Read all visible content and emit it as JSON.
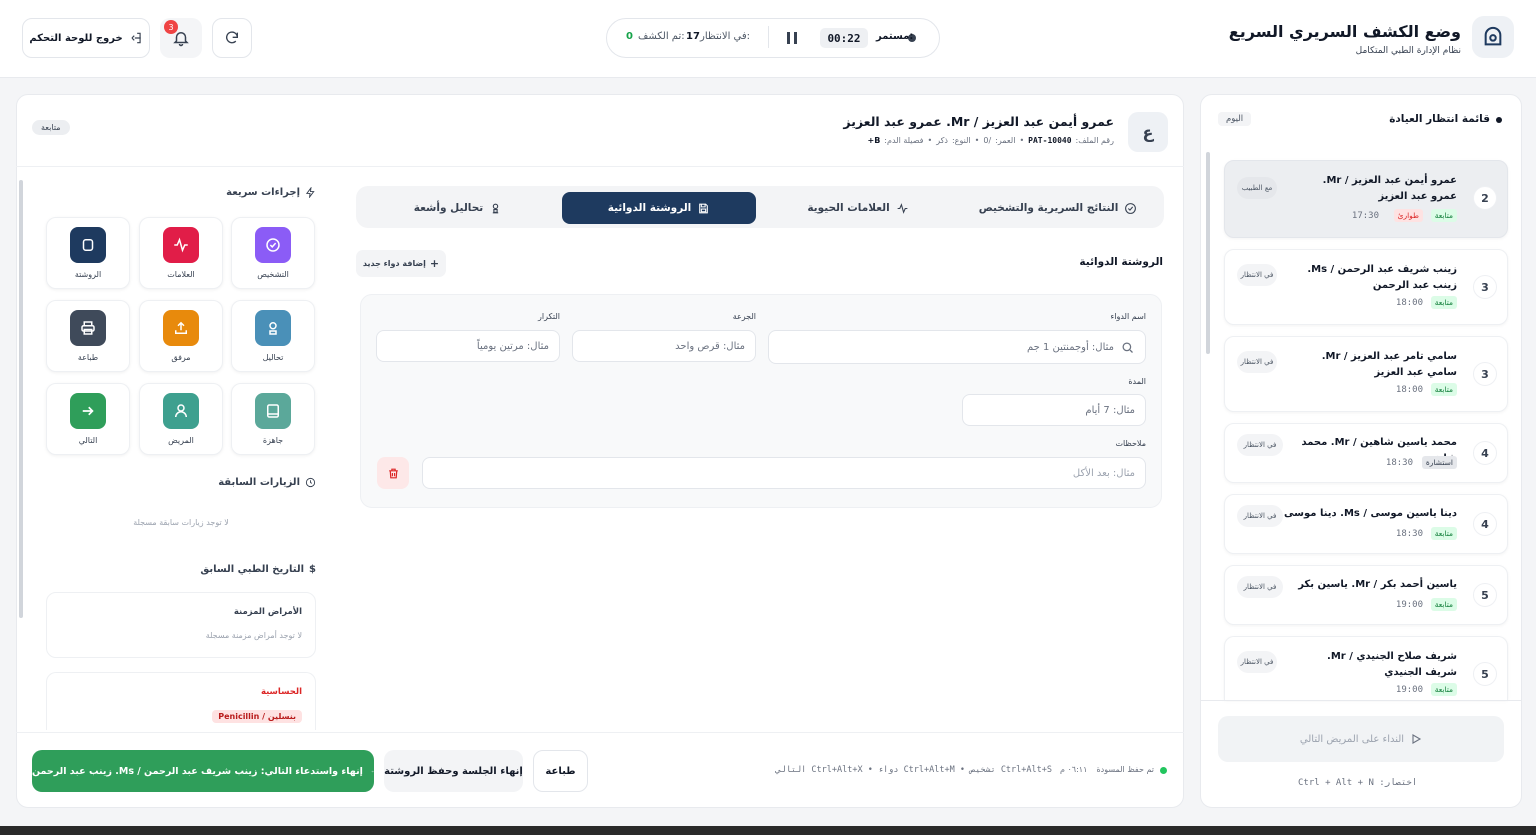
{
  "header": {
    "brand_title": "وضع الكشف السريري السريع",
    "brand_subtitle": "نظام الإدارة الطبي المتكامل",
    "status_label": "مستمر:",
    "timer": "00:22",
    "waiting_label": "في الانتظار:",
    "waiting_count": "17",
    "examined_label": "تم الكشف:",
    "examined_count": "0",
    "exit_button": "خروج للوحة التحكم",
    "notification_count": "3"
  },
  "patient": {
    "avatar_letter": "ع",
    "name": "عمرو أيمن عبد العزيز / Mr. عمرو عبد العزيز",
    "file_label": "رقم الملف:",
    "file_number": "PAT-10040",
    "age_label": "العمر:",
    "age_value": "/0",
    "gender_label": "النوع:",
    "gender_value": "ذكر",
    "blood_label": "فصيلة الدم:",
    "blood_value": "B+",
    "followup_badge": "متابعة"
  },
  "tabs": [
    {
      "label": "النتائج السريرية والتشخيص"
    },
    {
      "label": "العلامات الحيوية"
    },
    {
      "label": "الروشتة الدوائية"
    },
    {
      "label": "تحاليل وأشعة"
    }
  ],
  "prescription": {
    "section_title": "الروشتة الدوائية",
    "add_button": "إضافة دواء جديد",
    "drug_label": "اسم الدواء",
    "drug_placeholder": "مثال: أوجمنتين 1 جم",
    "dose_label": "الجرعة",
    "dose_placeholder": "مثال: قرص واحد",
    "freq_label": "التكرار",
    "freq_placeholder": "مثال: مرتين يومياً",
    "duration_label": "المدة",
    "duration_placeholder": "مثال: 7 أيام",
    "notes_label": "ملاحظات",
    "notes_placeholder": "مثال: بعد الأكل"
  },
  "quick_actions": {
    "title": "إجراءات سريعة",
    "items": [
      {
        "label": "التشخيص",
        "color": "#8b5cf6"
      },
      {
        "label": "العلامات",
        "color": "#e11d48"
      },
      {
        "label": "الروشتة",
        "color": "#1e3a5f"
      },
      {
        "label": "تحاليل",
        "color": "#4a90b8"
      },
      {
        "label": "مرفق",
        "color": "#e88a0c"
      },
      {
        "label": "طباعة",
        "color": "#3f4a5a"
      },
      {
        "label": "جاهزة",
        "color": "#5ba89a"
      },
      {
        "label": "المريض",
        "color": "#3ea08f"
      },
      {
        "label": "التالي",
        "color": "#2f9e5a"
      }
    ]
  },
  "history": {
    "prev_visits_title": "الزيارات السابقة",
    "no_prev_visits": "لا توجد زيارات سابقة مسجلة",
    "medical_history_title": "التاريخ الطبي السابق",
    "chronic_title": "الأمراض المزمنة",
    "no_chronic": "لا توجد أمراض مزمنة مسجلة",
    "allergy_title": "الحساسية",
    "allergy_item": "بنسلين / Penicillin"
  },
  "footer": {
    "next_button": "إنهاء واستدعاء التالي: زينب شريف عبد الرحمن / Ms. زينب عبد الرحمن",
    "end_session_button": "إنهاء الجلسة وحفظ الروشتة",
    "print_button": "طباعة",
    "saved_status": "تم حفظ المسودة",
    "saved_time": "٠٦:١١ م",
    "shortcuts": "Ctrl+Alt+S تشخيص • Ctrl+Alt+M دواء • Ctrl+Alt+X التالي"
  },
  "queue": {
    "title": "قائمة انتظار العيادة",
    "today_badge": "اليوم",
    "call_next_button": "النداء على المريض التالي",
    "shortcut_hint": "اختصار: Ctrl + Alt + N",
    "items": [
      {
        "num": "2",
        "name": "عمرو أيمن عبد العزيز / Mr. عمرو عبد العزيز",
        "badges": [
          "متابعة",
          "طوارئ"
        ],
        "time": "17:30",
        "status": "مع الطبيب"
      },
      {
        "num": "3",
        "name": "زينب شريف عبد الرحمن / Ms. زينب عبد الرحمن",
        "badges": [
          "متابعة"
        ],
        "time": "18:00",
        "status": "في الانتظار"
      },
      {
        "num": "3",
        "name": "سامي تامر عبد العزيز / Mr. سامي عبد العزيز",
        "badges": [
          "متابعة"
        ],
        "time": "18:00",
        "status": "في الانتظار"
      },
      {
        "num": "4",
        "name": "محمد ياسين شاهين / Mr. محمد شاهين",
        "badges": [
          "استشارة"
        ],
        "time": "18:30",
        "status": "في الانتظار"
      },
      {
        "num": "4",
        "name": "دينا ياسين موسى / Ms. دينا موسى",
        "badges": [
          "متابعة"
        ],
        "time": "18:30",
        "status": "في الانتظار"
      },
      {
        "num": "5",
        "name": "ياسين أحمد بكر / Mr. ياسين بكر",
        "badges": [
          "متابعة"
        ],
        "time": "19:00",
        "status": "في الانتظار"
      },
      {
        "num": "5",
        "name": "شريف صلاح الجنيدي / Mr. شريف الجنيدي",
        "badges": [
          "متابعة"
        ],
        "time": "19:00",
        "status": "في الانتظار"
      }
    ]
  },
  "colors": {
    "primary_navy": "#1e3a5f",
    "accent_green": "#2f9e5a",
    "danger_red": "#dc2626",
    "followup_green": "#15803d",
    "emergency_red": "#dc2626"
  }
}
